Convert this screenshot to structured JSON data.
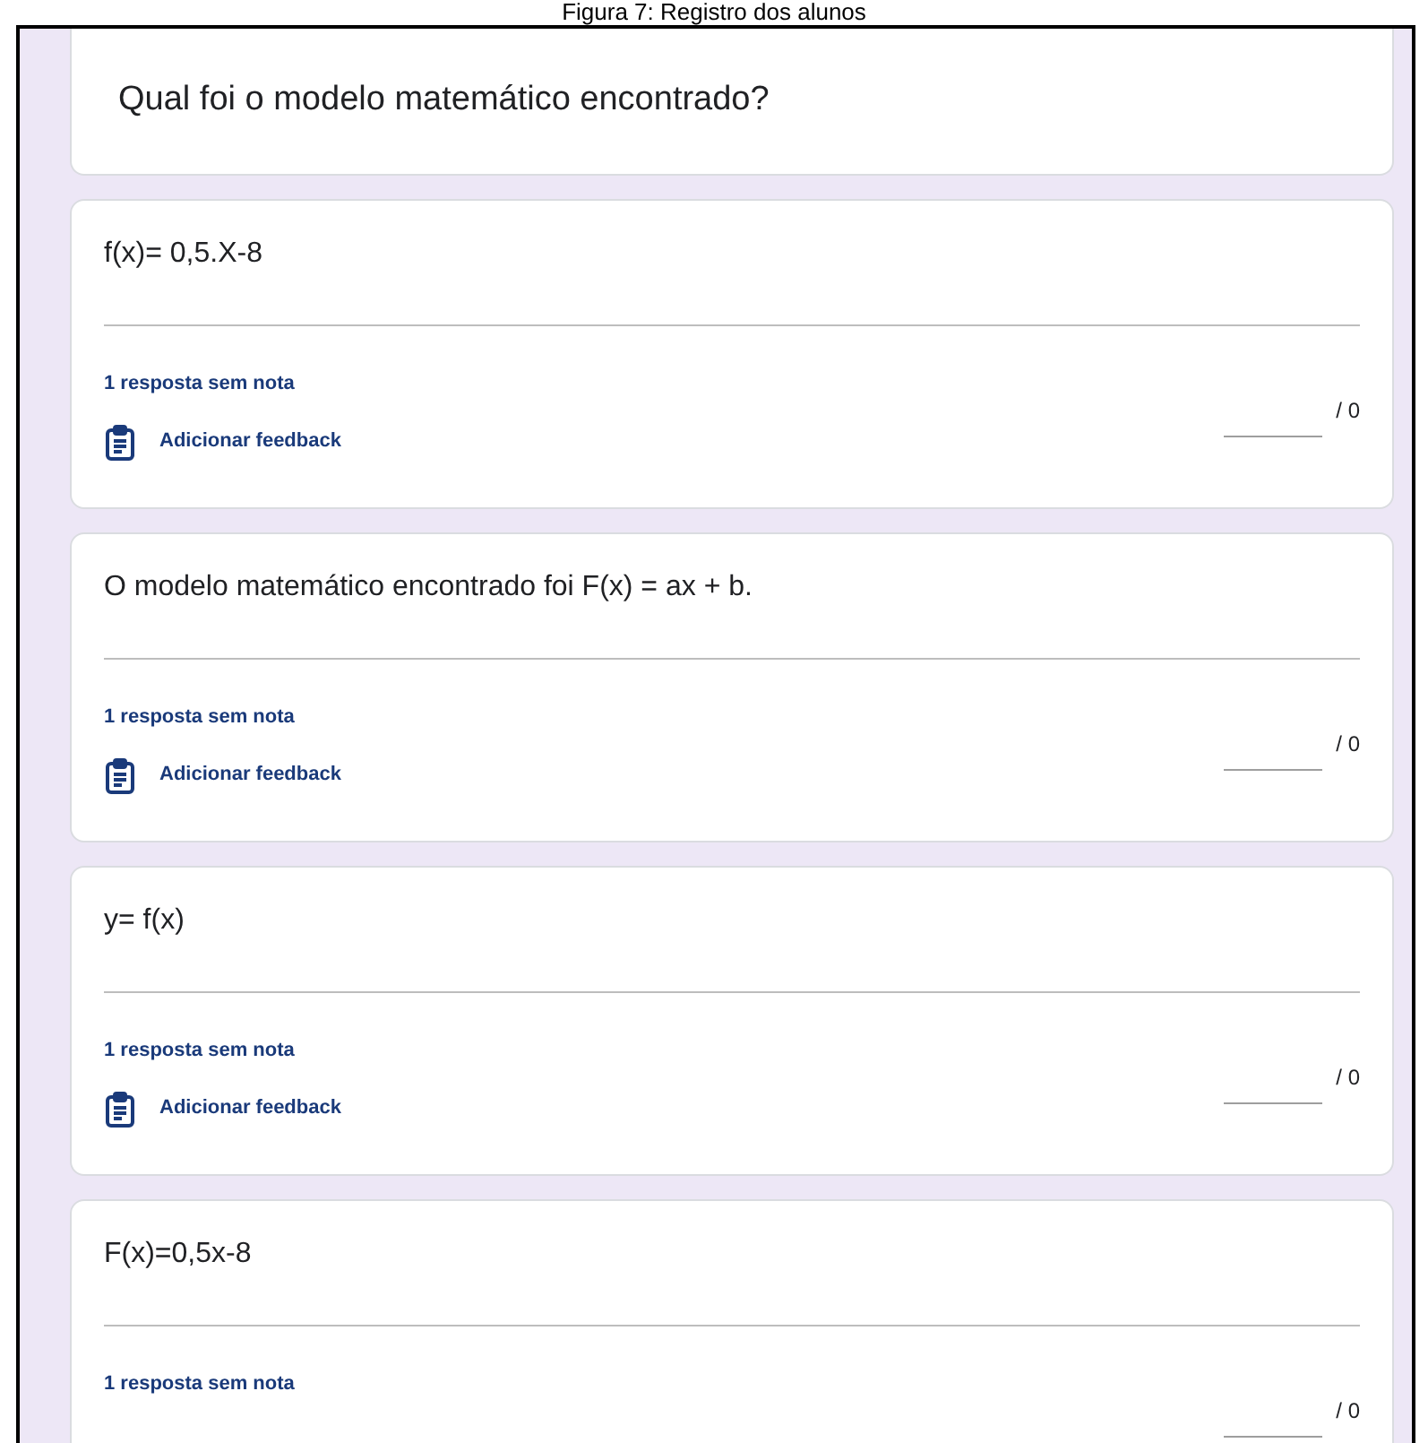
{
  "caption": "Figura 7: Registro dos alunos",
  "question": {
    "title": "Qual foi o modelo matemático encontrado?"
  },
  "answers": [
    {
      "text": "f(x)= 0,5.X-8",
      "status": "1 resposta sem nota",
      "feedback": "Adicionar feedback",
      "points": "/ 0"
    },
    {
      "text": "O modelo matemático encontrado foi F(x) = ax + b.",
      "status": "1 resposta sem nota",
      "feedback": "Adicionar feedback",
      "points": "/ 0"
    },
    {
      "text": "y= f(x)",
      "status": "1 resposta sem nota",
      "feedback": "Adicionar feedback",
      "points": "/ 0"
    },
    {
      "text": "F(x)=0,5x-8",
      "status": "1 resposta sem nota",
      "points": "/ 0"
    }
  ]
}
